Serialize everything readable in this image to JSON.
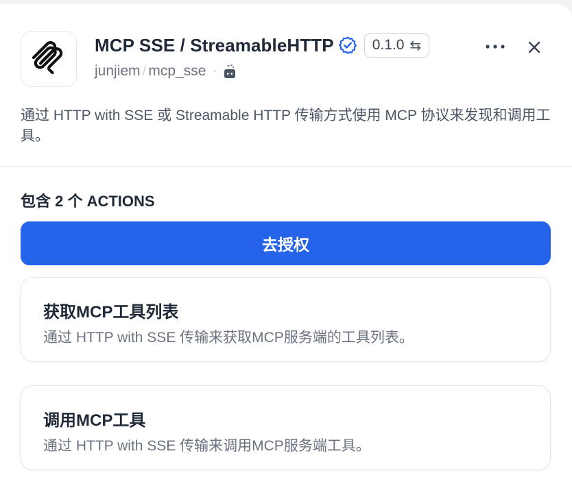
{
  "header": {
    "title": "MCP SSE / StreamableHTTP",
    "version": "0.1.0",
    "owner": "junjiem",
    "repo": "mcp_sse",
    "verified_icon": "verified-badge-icon",
    "swap_icon": "switch-arrows-icon",
    "repo_type_icon": "plugin-bot-icon"
  },
  "description": "通过 HTTP with SSE 或 Streamable HTTP 传输方式使用 MCP 协议来发现和调用工具。",
  "actions": {
    "count_label": "包含 2 个 ACTIONS",
    "authorize_label": "去授权",
    "items": [
      {
        "title": "获取MCP工具列表",
        "description": "通过 HTTP with SSE 传输来获取MCP服务端的工具列表。"
      },
      {
        "title": "调用MCP工具",
        "description": "通过 HTTP with SSE 传输来调用MCP服务端工具。"
      }
    ]
  },
  "colors": {
    "accent": "#2563eb",
    "text": "#1f2937",
    "muted": "#6b7280"
  }
}
